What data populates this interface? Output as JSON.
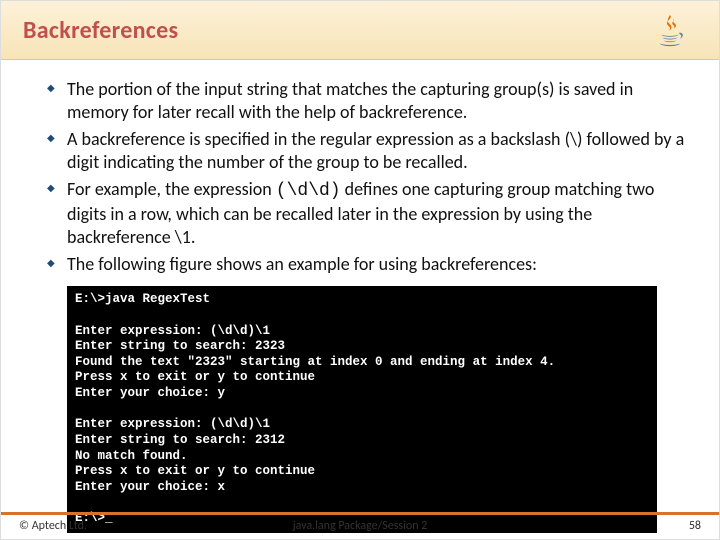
{
  "title": "Backreferences",
  "logo_name": "java-logo",
  "bullets": [
    {
      "pre": "The portion of the input string that matches the capturing group(s) is saved in memory for later recall with the help of backreference."
    },
    {
      "pre": "A backreference is specified in the regular expression as a backslash (\\) followed by a digit indicating the number of the group to be recalled."
    },
    {
      "pre": "For example, the expression ",
      "code": "(\\d\\d)",
      "post": " defines one capturing group matching two digits in a row, which can be recalled later in the expression by using the backreference \\1."
    },
    {
      "pre": "The following figure shows an example for using backreferences:"
    }
  ],
  "terminal": {
    "l0": "E:\\>java RegexTest",
    "l1": "",
    "l2": "Enter expression: (\\d\\d)\\1",
    "l3": "Enter string to search: 2323",
    "l4": "Found the text \"2323\" starting at index 0 and ending at index 4.",
    "l5": "Press x to exit or y to continue",
    "l6": "Enter your choice: y",
    "l7": "",
    "l8": "Enter expression: (\\d\\d)\\1",
    "l9": "Enter string to search: 2312",
    "l10": "No match found.",
    "l11": "Press x to exit or y to continue",
    "l12": "Enter your choice: x",
    "l13": "",
    "l14": "E:\\>_"
  },
  "footer": {
    "left": "© Aptech Ltd.",
    "center": "java.lang Package/Session 2",
    "right": "58"
  }
}
